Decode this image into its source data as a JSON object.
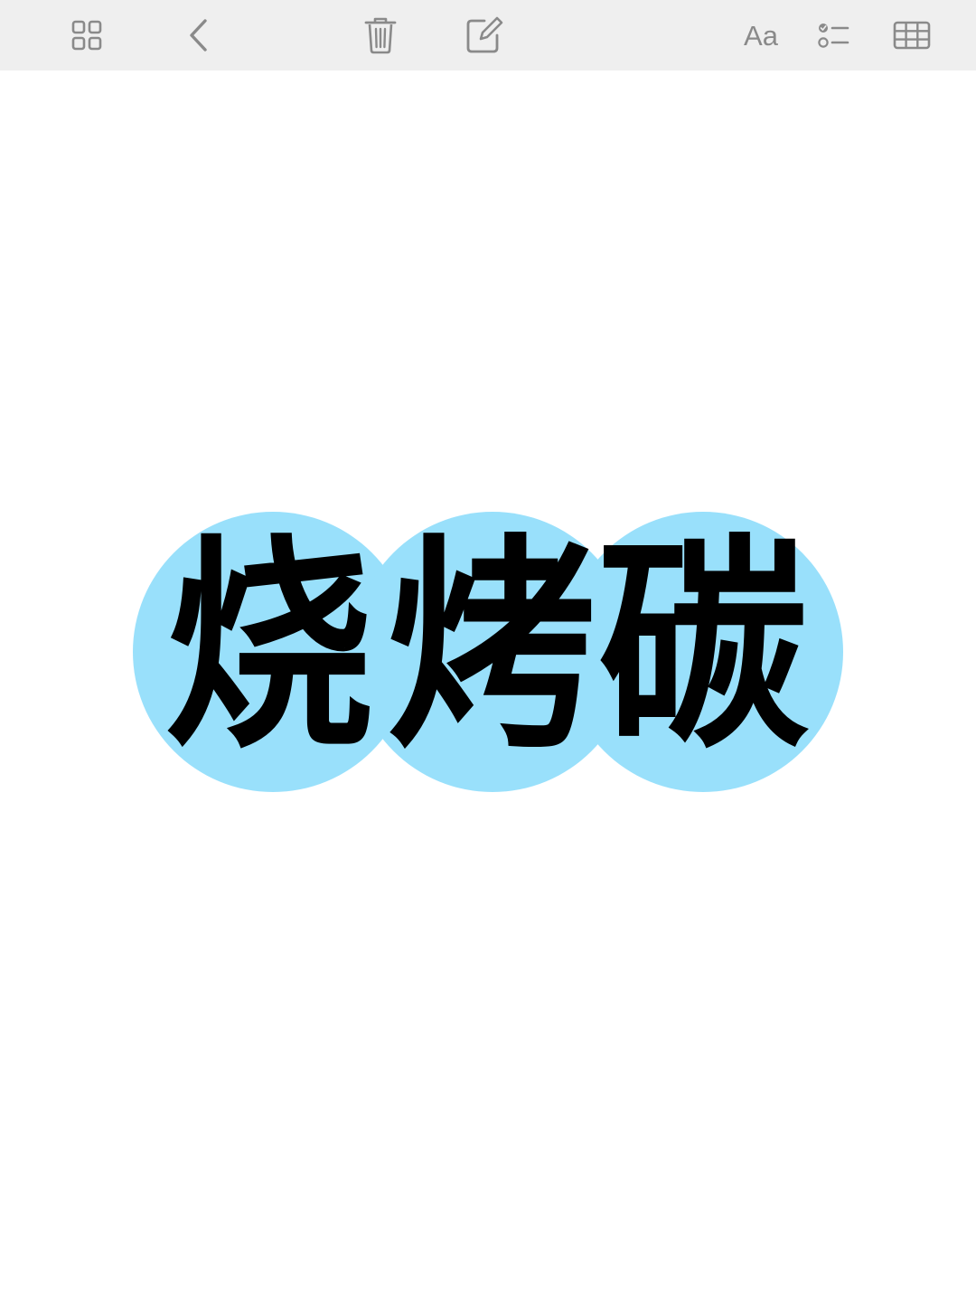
{
  "toolbar": {
    "background": "#efefef",
    "icon_color": "#8a8a8a",
    "buttons": [
      {
        "name": "grid-view",
        "icon": "grid-icon"
      },
      {
        "name": "back",
        "icon": "chevron-left-icon"
      },
      {
        "name": "delete",
        "icon": "trash-icon"
      },
      {
        "name": "compose",
        "icon": "compose-icon"
      },
      {
        "name": "format",
        "icon": "text-format-icon",
        "label": "Aa"
      },
      {
        "name": "checklist",
        "icon": "checklist-icon"
      },
      {
        "name": "table",
        "icon": "table-icon"
      }
    ]
  },
  "note": {
    "title_chars": [
      "烧",
      "烤",
      "碳"
    ],
    "bubble_color": "#99e0fb",
    "text_color": "#000000"
  }
}
